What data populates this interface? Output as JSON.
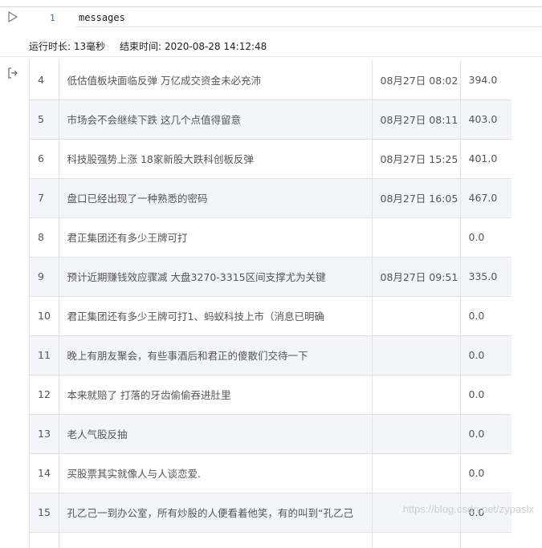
{
  "editor": {
    "line_number": "1",
    "code": "messages"
  },
  "exec_info": {
    "duration": "运行时长: 13毫秒",
    "end_time": "结束时间: 2020-08-28 14:12:48"
  },
  "table": {
    "rows": [
      {
        "idx": "4",
        "title": "低估值板块面临反弹 万亿成交资金未必充沛",
        "time": "08月27日 08:02",
        "val": "394.0"
      },
      {
        "idx": "5",
        "title": "市场会不会继续下跌 这几个点值得留意",
        "time": "08月27日 08:11",
        "val": "403.0"
      },
      {
        "idx": "6",
        "title": "科技股强势上涨 18家新股大跌科创板反弹",
        "time": "08月27日 15:25",
        "val": "401.0"
      },
      {
        "idx": "7",
        "title": "盘口已经出现了一种熟悉的密码",
        "time": "08月27日 16:05",
        "val": "467.0"
      },
      {
        "idx": "8",
        "title": "君正集团还有多少王牌可打",
        "time": "",
        "val": "0.0"
      },
      {
        "idx": "9",
        "title": "预计近期赚钱效应骤减 大盘3270-3315区间支撑尤为关键",
        "time": "08月27日 09:51",
        "val": "335.0"
      },
      {
        "idx": "10",
        "title": "君正集团还有多少王牌可打1、蚂蚁科技上市（消息已明确",
        "time": "",
        "val": "0.0"
      },
      {
        "idx": "11",
        "title": "晚上有朋友聚会，有些事酒后和君正的傻散们交待一下",
        "time": "",
        "val": "0.0"
      },
      {
        "idx": "12",
        "title": "本来就赔了 打落的牙齿偷偷吞进肚里",
        "time": "",
        "val": "0.0"
      },
      {
        "idx": "13",
        "title": "老人气股反抽",
        "time": "",
        "val": "0.0"
      },
      {
        "idx": "14",
        "title": "买股票其实就像人与人谈恋爱.",
        "time": "",
        "val": "0.0"
      },
      {
        "idx": "15",
        "title": "孔乙己一到办公室，所有炒股的人便看着他笑，有的叫到“孔乙己",
        "time": "",
        "val": "0.0"
      },
      {
        "idx": "",
        "title": "",
        "time": "",
        "val": ""
      }
    ]
  },
  "watermark": "https://blog.csdn.net/zypaslx"
}
